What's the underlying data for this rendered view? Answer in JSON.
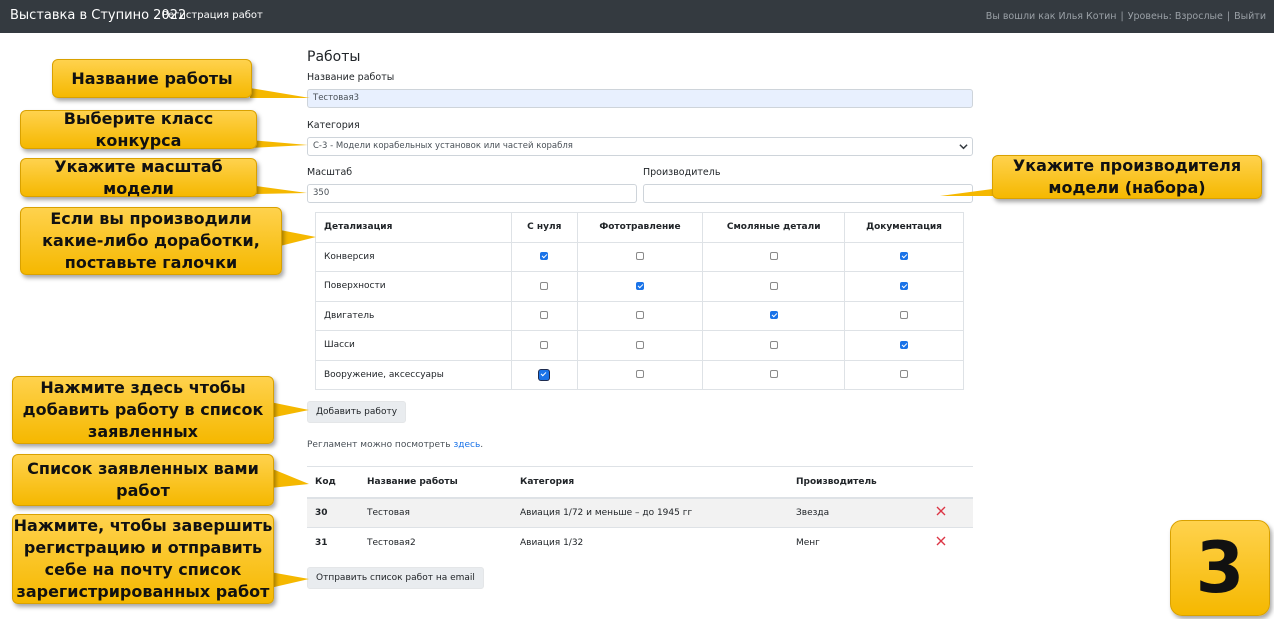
{
  "navbar": {
    "brand": "Выставка в Ступино 2022",
    "link": "Регистрация работ",
    "user": "Вы вошли как Илья Котин",
    "level": "Уровень: Взрослые",
    "logout": "Выйти",
    "sep": "|"
  },
  "form": {
    "title": "Работы",
    "name_label": "Название работы",
    "name_value": "Тестовая3",
    "category_label": "Категория",
    "category_value": "С-3 - Модели корабельных установок или частей корабля",
    "scale_label": "Масштаб",
    "scale_value": "350",
    "maker_label": "Производитель",
    "maker_value": ""
  },
  "detail": {
    "headers": [
      "Детализация",
      "С нуля",
      "Фототравление",
      "Смоляные детали",
      "Документация"
    ],
    "rows": [
      {
        "label": "Конверсия",
        "checks": [
          true,
          false,
          false,
          true
        ]
      },
      {
        "label": "Поверхности",
        "checks": [
          false,
          true,
          false,
          true
        ]
      },
      {
        "label": "Двигатель",
        "checks": [
          false,
          false,
          true,
          false
        ]
      },
      {
        "label": "Шасси",
        "checks": [
          false,
          false,
          false,
          true
        ]
      },
      {
        "label": "Вооружение, аксессуары",
        "checks": [
          true,
          false,
          false,
          false
        ]
      }
    ]
  },
  "add_button": "Добавить работу",
  "regulation": {
    "text": "Регламент можно посмотреть ",
    "link": "здесь",
    "end": "."
  },
  "list": {
    "headers": [
      "Код",
      "Название работы",
      "Категория",
      "Производитель",
      ""
    ],
    "rows": [
      {
        "code": "30",
        "name": "Тестовая",
        "category": "Авиация 1/72 и меньше – до 1945 гг",
        "maker": "Звезда"
      },
      {
        "code": "31",
        "name": "Тестовая2",
        "category": "Авиация 1/32",
        "maker": "Менг"
      }
    ]
  },
  "send_button": "Отправить список работ на email",
  "callouts": {
    "name": "Название работы",
    "class": "Выберите класс конкурса",
    "scale": "Укажите масштаб модели",
    "maker": "Укажите производителя модели (набора)",
    "detail": "Если вы производили какие-либо доработки, поставьте галочки",
    "add": "Нажмите здесь чтобы добавить работу в список заявленных",
    "list": "Список заявленных вами работ",
    "finish": "Нажмите, чтобы завершить регистрацию и отправить себе на почту список зарегистрированных работ"
  },
  "step_number": "3",
  "colors": {
    "navbar": "#343a40",
    "callout": "#f5b800",
    "checked": "#1a73e8",
    "delete": "#dc3545"
  }
}
